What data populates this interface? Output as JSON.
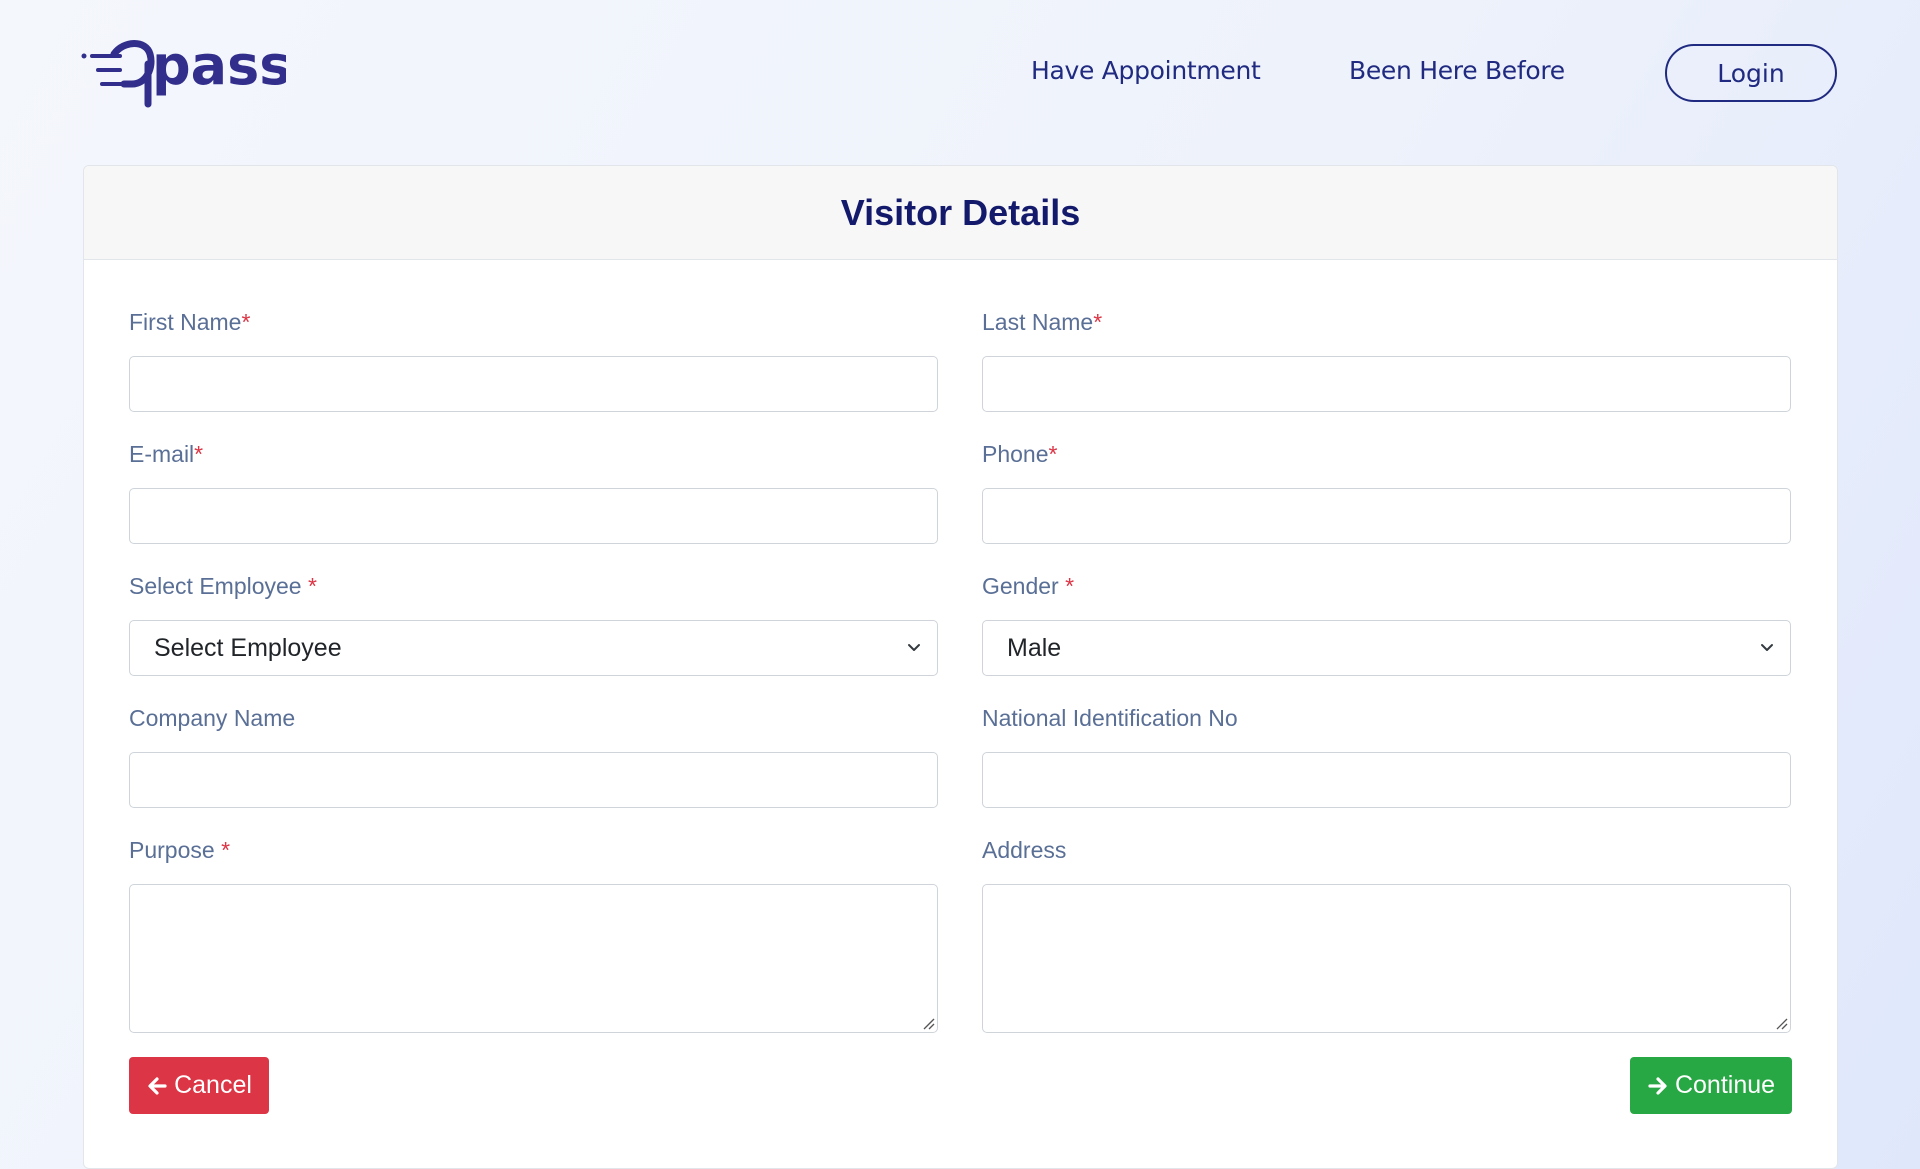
{
  "brand": {
    "logo_text": "pass",
    "color": "#312e8c"
  },
  "nav": {
    "have_appointment": "Have Appointment",
    "been_here_before": "Been Here Before",
    "login": "Login"
  },
  "card": {
    "title": "Visitor Details"
  },
  "form": {
    "first_name": {
      "label": "First Name",
      "required": "*",
      "value": ""
    },
    "last_name": {
      "label": "Last Name",
      "required": "*",
      "value": ""
    },
    "email": {
      "label": "E-mail",
      "required": "*",
      "value": ""
    },
    "phone": {
      "label": "Phone",
      "required": "*",
      "value": ""
    },
    "employee": {
      "label": "Select Employee ",
      "required": "*",
      "selected": "Select Employee"
    },
    "gender": {
      "label": "Gender ",
      "required": "*",
      "selected": "Male"
    },
    "company": {
      "label": "Company Name",
      "value": ""
    },
    "national_id": {
      "label": "National Identification No",
      "value": ""
    },
    "purpose": {
      "label": "Purpose ",
      "required": "*",
      "value": ""
    },
    "address": {
      "label": "Address",
      "value": ""
    }
  },
  "actions": {
    "cancel": "Cancel",
    "continue": "Continue"
  },
  "colors": {
    "primary_navy": "#1f2a80",
    "title": "#141a6b",
    "label": "#5a6f96",
    "required": "#dc3545",
    "cancel": "#dc3545",
    "continue": "#28a745"
  }
}
